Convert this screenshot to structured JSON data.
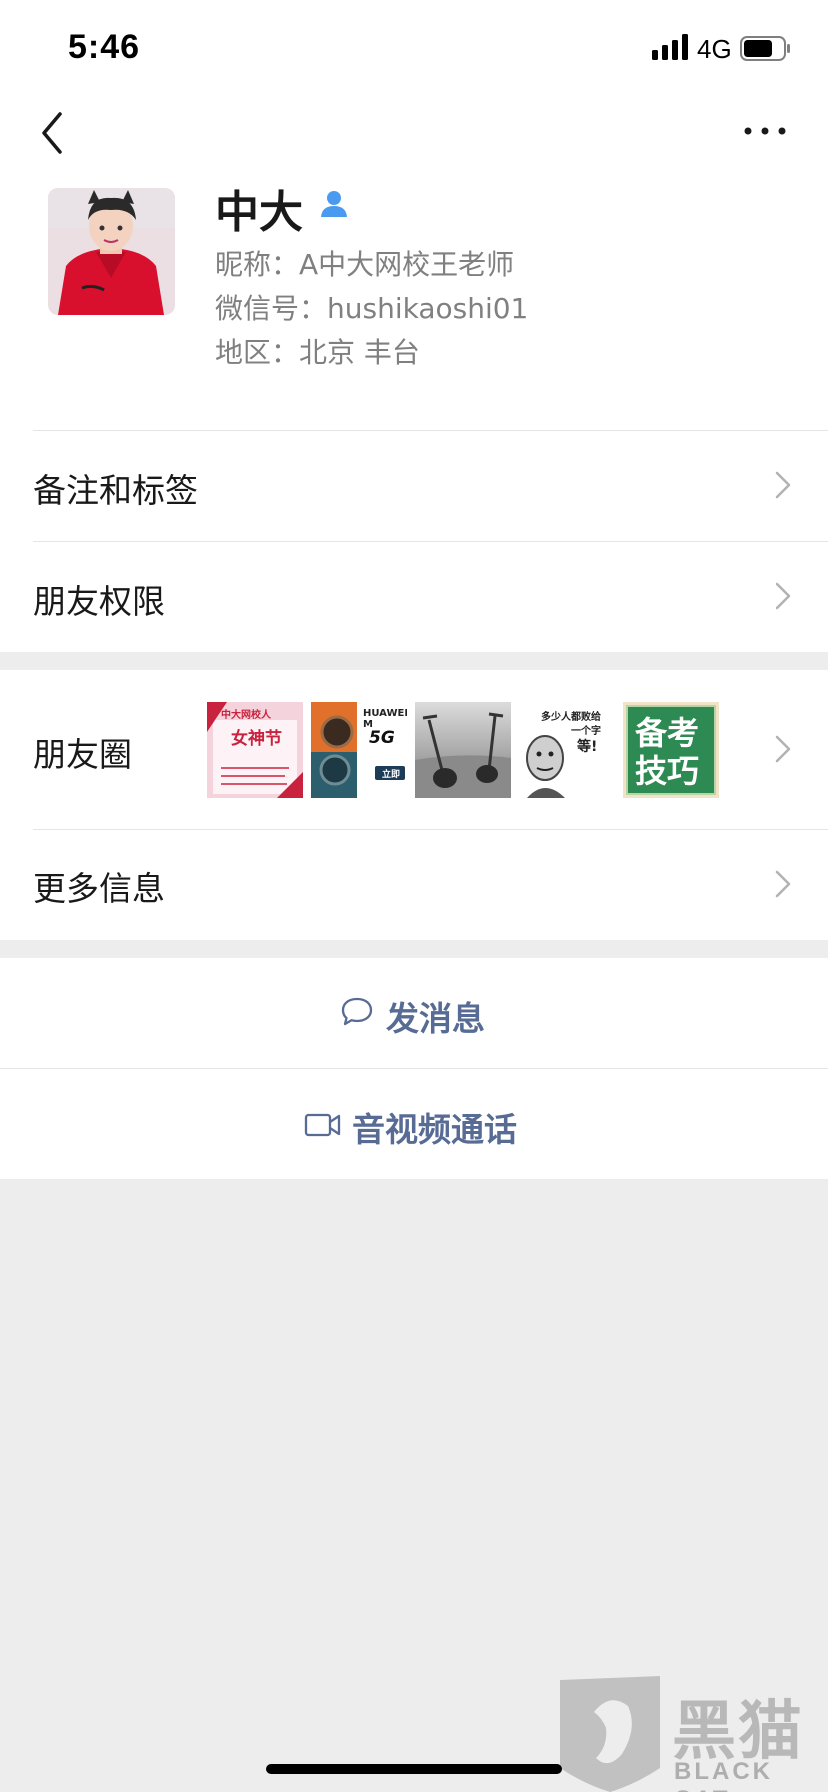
{
  "status_bar": {
    "time": "5:46",
    "network": "4G"
  },
  "profile": {
    "name": "中大",
    "nickname": "昵称：A中大网校王老师",
    "wechat_id": "微信号：hushikaoshi01",
    "region": "地区：北京 丰台"
  },
  "menu": {
    "remark_tags": "备注和标签",
    "friend_permissions": "朋友权限",
    "moments": "朋友圈",
    "more_info": "更多信息"
  },
  "moments_thumbs": {
    "t1_brand": "中大网校人",
    "t1_title": "女神节",
    "t2_brand": "HUAWEI M",
    "t2_tag": "5G",
    "t2_btn": "立即",
    "t4_line1": "多少人都败给",
    "t4_line2": "一个字",
    "t4_line3": "等!",
    "t5_line1": "备考",
    "t5_line2": "技巧"
  },
  "actions": {
    "send_message": "发消息",
    "video_call": "音视频通话"
  },
  "watermark": {
    "title": "黑猫",
    "subtitle": "BLACK CAT"
  },
  "colors": {
    "link": "#576b95",
    "accent_icon": "#4a9bf0"
  }
}
